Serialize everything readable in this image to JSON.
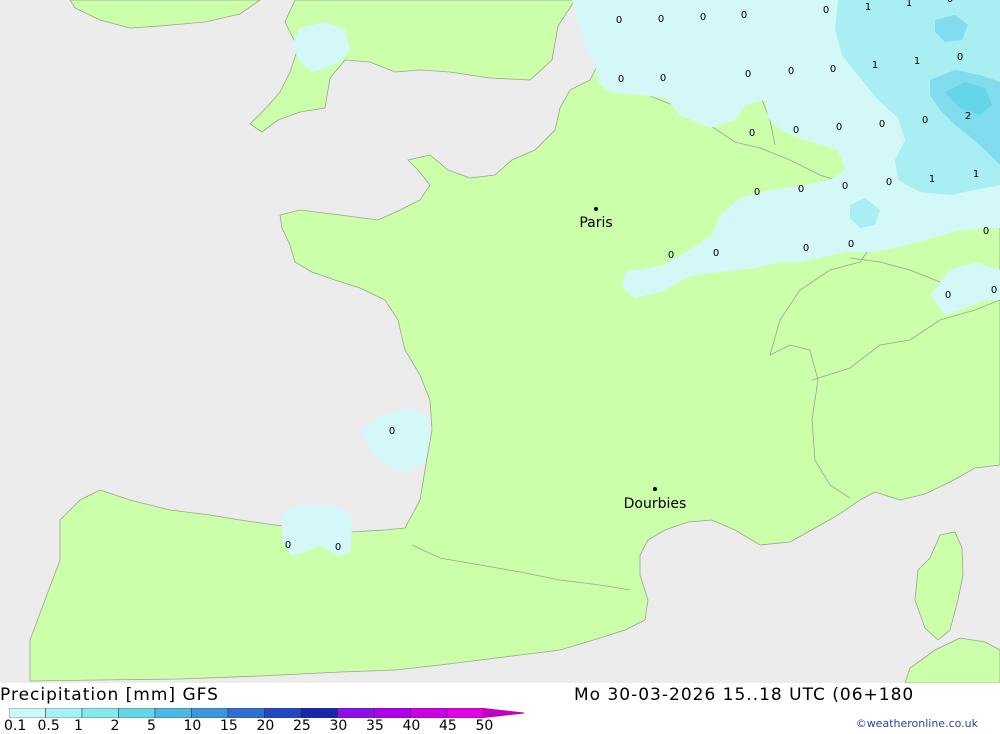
{
  "footer": {
    "title_left": "Precipitation [mm] GFS",
    "title_right": "Mo 30-03-2026 15..18 UTC (06+180",
    "credit": "©weatheronline.co.uk"
  },
  "legend": {
    "labels": [
      "0.1",
      "0.5",
      "1",
      "2",
      "5",
      "10",
      "15",
      "20",
      "25",
      "30",
      "35",
      "40",
      "45",
      "50"
    ],
    "colors": [
      "#ccf8f8",
      "#a6f2f2",
      "#84e8ec",
      "#64d6e8",
      "#4cb8e4",
      "#3c96dc",
      "#2f6fd2",
      "#2448c2",
      "#1428a8",
      "#8a10ec",
      "#ae00ec",
      "#cc00e6",
      "#e400e4",
      "#c200c2"
    ]
  },
  "map": {
    "colors": {
      "sea": "#ececec",
      "land": "#ccffaa",
      "rain_light": "#d4f8f8",
      "rain_mid": "#a9eef2",
      "rain_heavy": "#80dcee"
    },
    "cities": [
      {
        "name": "Paris"
      },
      {
        "name": "Dourbies"
      }
    ],
    "values": [
      "0",
      "0",
      "0",
      "0",
      "0",
      "1",
      "1",
      "0",
      "0",
      "0",
      "0",
      "0",
      "0",
      "1",
      "1",
      "0",
      "0",
      "0",
      "0",
      "0",
      "0",
      "2",
      "0",
      "0",
      "0",
      "0",
      "1",
      "1",
      "0",
      "0",
      "0",
      "0",
      "0",
      "0",
      "0",
      "0",
      "0",
      "0",
      "0",
      "0",
      "0"
    ]
  }
}
